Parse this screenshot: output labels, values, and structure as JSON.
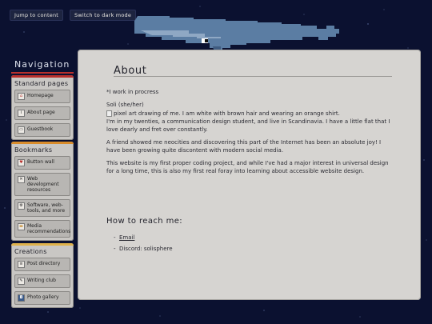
{
  "skip_links": {
    "jump": "Jump to content",
    "dark_mode": "Switch to dark mode"
  },
  "nav": {
    "title": "Navigation",
    "sections": [
      {
        "heading": "Standard pages",
        "items": [
          "Homepage",
          "About page",
          "Guestbook"
        ]
      },
      {
        "heading": "Bookmarks",
        "items": [
          "Button wall",
          "Web development resources",
          "Software, web-tools, and more",
          "Media recommendations"
        ]
      },
      {
        "heading": "Creations",
        "items": [
          "Post directory",
          "Writing club",
          "Photo gallery"
        ]
      }
    ]
  },
  "main": {
    "title": "About",
    "notice": "*I work in procress",
    "pronouns": "Soli (she/her)",
    "img_alt": "pixel art drawing of me. I am white with brown hair and wearing an orange shirt.",
    "p1": "I'm in my twenties, a communication design student, and live in Scandinavia. I have a little flat that I love dearly and fret over constantly.",
    "p2": "A friend showed me neocities and discovering this part of the Internet has been an absolute joy! I have been growing quite discontent with modern social media.",
    "p3": "This website is my first proper coding project, and while I've had a major interest in universal design for a long time, this is also my first real foray into learning about accessible website design.",
    "reach_heading": "How to reach me:",
    "email": "Email",
    "discord": "Discord: solisphere"
  },
  "colors": {
    "background": "#0b1130",
    "panel": "#c9c7c4",
    "standard_bar": "#b9302c",
    "bookmarks_bar": "#d98c2b",
    "creations_bar": "#e0b24a"
  }
}
